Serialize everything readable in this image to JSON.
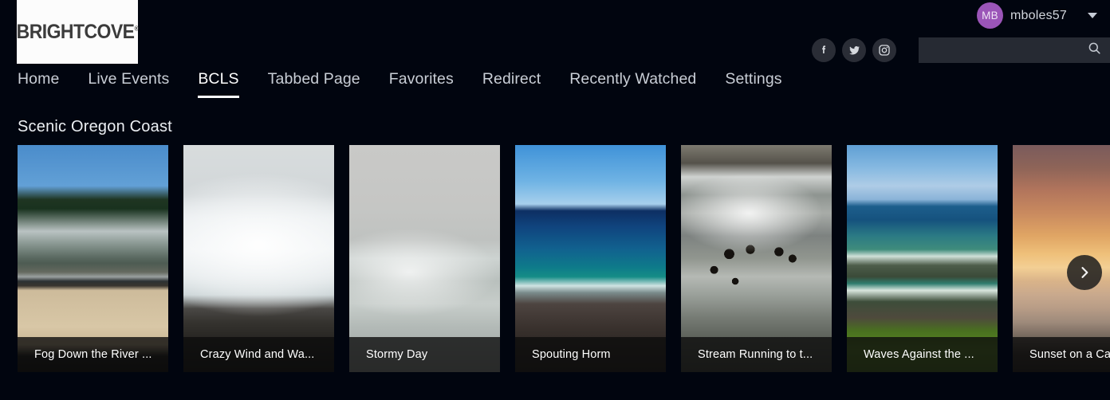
{
  "header": {
    "logo_text": "BRIGHTCOVE",
    "logo_reg": "®",
    "user": {
      "initials": "MB",
      "name": "mboles57",
      "avatar_color": "#9b55b8"
    },
    "social": [
      {
        "name": "facebook-icon",
        "label": "Facebook"
      },
      {
        "name": "twitter-icon",
        "label": "Twitter"
      },
      {
        "name": "instagram-icon",
        "label": "Instagram"
      }
    ],
    "search": {
      "value": "",
      "placeholder": "",
      "icon": "search-icon"
    }
  },
  "nav": {
    "items": [
      {
        "label": "Home",
        "active": false
      },
      {
        "label": "Live Events",
        "active": false
      },
      {
        "label": "BCLS",
        "active": true
      },
      {
        "label": "Tabbed Page",
        "active": false
      },
      {
        "label": "Favorites",
        "active": false
      },
      {
        "label": "Redirect",
        "active": false
      },
      {
        "label": "Recently Watched",
        "active": false
      },
      {
        "label": "Settings",
        "active": false
      }
    ]
  },
  "main": {
    "section_title": "Scenic Oregon Coast",
    "next_button_label": "Next",
    "next_icon": "chevron-right-icon",
    "cards": [
      {
        "title": "Fog Down the River ...",
        "art": "t-fog"
      },
      {
        "title": "Crazy Wind and Wa...",
        "art": "t-crazy"
      },
      {
        "title": "Stormy Day",
        "art": "t-stormy"
      },
      {
        "title": "Spouting Horm",
        "art": "t-spouting"
      },
      {
        "title": "Stream Running to t...",
        "art": "t-stream"
      },
      {
        "title": "Waves Against the ...",
        "art": "t-waves"
      },
      {
        "title": "Sunset on a Ca",
        "art": "t-sunset"
      }
    ]
  },
  "colors": {
    "background": "#01050f",
    "accent_white": "#ffffff",
    "nav_text": "#c9ced6",
    "card_title_bg": "rgba(12,12,12,0.80)"
  }
}
